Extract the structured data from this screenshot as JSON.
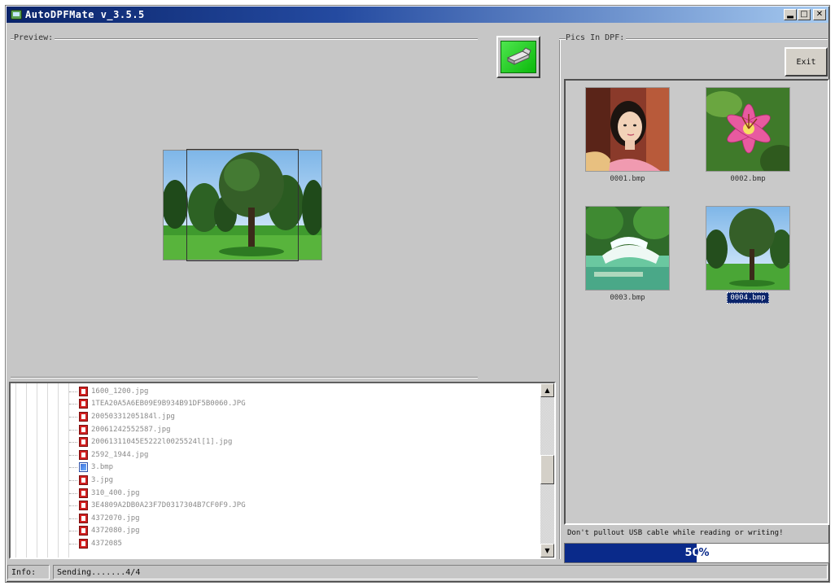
{
  "window": {
    "title": "AutoDPFMate v_3.5.5"
  },
  "preview": {
    "label": "Preview:"
  },
  "file_list": {
    "items": [
      {
        "name": "1600_1200.jpg",
        "type": "jpg"
      },
      {
        "name": "1TEA20A5A6EB09E9B934B91DF5B0060.JPG",
        "type": "jpg"
      },
      {
        "name": "20050331205184l.jpg",
        "type": "jpg"
      },
      {
        "name": "20061242552587.jpg",
        "type": "jpg"
      },
      {
        "name": "20061311045E5222l0025524l[1].jpg",
        "type": "jpg"
      },
      {
        "name": "2592_1944.jpg",
        "type": "jpg"
      },
      {
        "name": "3.bmp",
        "type": "bmp"
      },
      {
        "name": "3.jpg",
        "type": "jpg"
      },
      {
        "name": "310_400.jpg",
        "type": "jpg"
      },
      {
        "name": "3E4809A2DB0A23F7D0317304B7CF0F9.JPG",
        "type": "jpg"
      },
      {
        "name": "4372070.jpg",
        "type": "jpg"
      },
      {
        "name": "4372080.jpg",
        "type": "jpg"
      },
      {
        "name": "4372085",
        "type": "jpg"
      }
    ]
  },
  "pics": {
    "label": "Pics In DPF:",
    "exit_label": "Exit",
    "items": [
      {
        "name": "0001.bmp",
        "image": "woman-portrait"
      },
      {
        "name": "0002.bmp",
        "image": "pink-lily-flower"
      },
      {
        "name": "0003.bmp",
        "image": "waterfall"
      },
      {
        "name": "0004.bmp",
        "image": "park-trees",
        "selected": true
      }
    ]
  },
  "warning": "Don't pullout USB cable while reading or writing!",
  "progress": {
    "value": 0.5,
    "text": "50%"
  },
  "status": {
    "label": "Info:",
    "text": "Sending.......4/4"
  },
  "colors": {
    "progress_fill": "#0a2a8a",
    "selection": "#0a246a",
    "send_button": "#22cc22"
  }
}
